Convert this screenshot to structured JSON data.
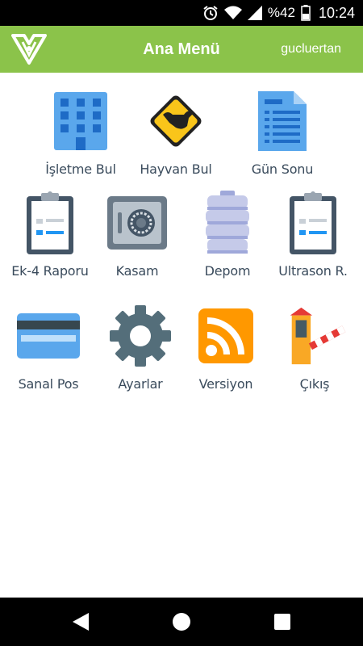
{
  "status_bar": {
    "battery_text": "%42",
    "time": "10:24"
  },
  "app_bar": {
    "title": "Ana Menü",
    "user": "gucluertan"
  },
  "menu": {
    "items": [
      {
        "label": "İşletme Bul",
        "icon": "building-icon"
      },
      {
        "label": "Hayvan Bul",
        "icon": "cattle-warning-sign-icon"
      },
      {
        "label": "Gün Sonu",
        "icon": "document-icon"
      },
      {
        "label": "Ek-4 Raporu",
        "icon": "clipboard-icon"
      },
      {
        "label": "Kasam",
        "icon": "safe-icon"
      },
      {
        "label": "Depom",
        "icon": "storage-tank-icon"
      },
      {
        "label": "Ultrason R.",
        "icon": "clipboard-icon"
      },
      {
        "label": "Sanal Pos",
        "icon": "credit-card-icon"
      },
      {
        "label": "Ayarlar",
        "icon": "gear-icon"
      },
      {
        "label": "Versiyon",
        "icon": "rss-icon"
      },
      {
        "label": "Çıkış",
        "icon": "barrier-gate-icon"
      }
    ]
  },
  "colors": {
    "app_bar": "#8bc34a",
    "label_text": "#3a4b5c",
    "status_bar": "#000000"
  }
}
